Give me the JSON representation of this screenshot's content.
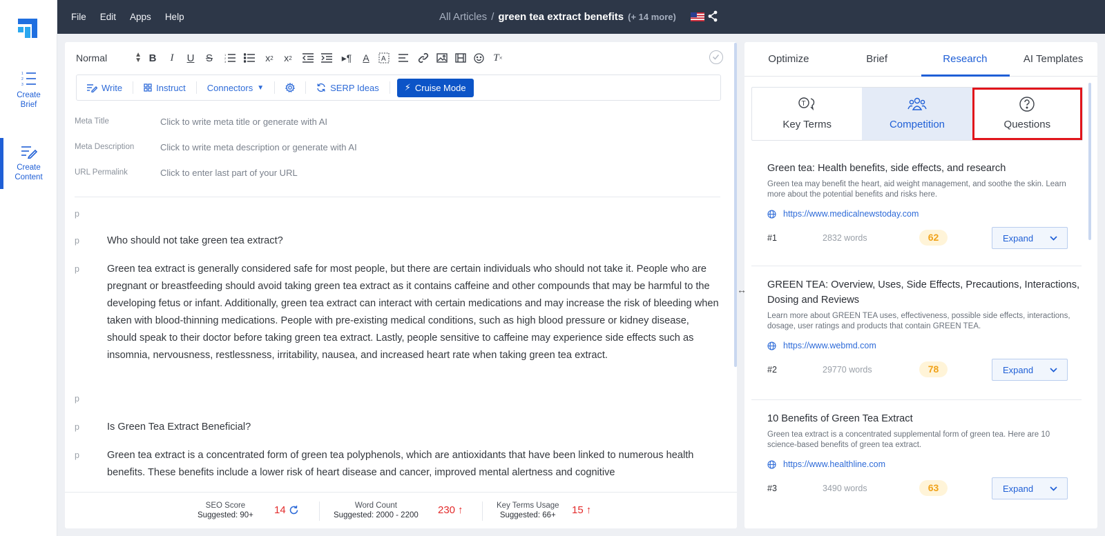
{
  "rail": {
    "create_brief": "Create\nBrief",
    "create_content": "Create\nContent"
  },
  "topbar": {
    "menu": [
      "File",
      "Edit",
      "Apps",
      "Help"
    ],
    "crumb_all": "All Articles",
    "crumb_sep": "/",
    "crumb_current": "green tea extract benefits",
    "crumb_more": "(+ 14 more)"
  },
  "editor": {
    "style_select": "Normal",
    "actions": {
      "write": "Write",
      "instruct": "Instruct",
      "connectors": "Connectors",
      "serp": "SERP Ideas",
      "cruise": "Cruise Mode"
    },
    "meta": [
      {
        "label": "Meta Title",
        "placeholder": "Click to write meta title or generate with AI"
      },
      {
        "label": "Meta Description",
        "placeholder": "Click to write meta description or generate with AI"
      },
      {
        "label": "URL Permalink",
        "placeholder": "Click to enter last part of your URL"
      }
    ],
    "paragraphs": [
      {
        "tag": "p",
        "text": ""
      },
      {
        "tag": "p",
        "text": "Who should not take green tea extract?"
      },
      {
        "tag": "p",
        "text": "Green tea extract is generally considered safe for most people, but there are certain individuals who should not take it. People who are pregnant or breastfeeding should avoid taking green tea extract as it contains caffeine and other compounds that may be harmful to the developing fetus or infant. Additionally, green tea extract can interact with certain medications and may increase the risk of bleeding when taken with blood-thinning medications. People with pre-existing medical conditions, such as high blood pressure or kidney disease, should speak to their doctor before taking green tea extract. Lastly, people sensitive to caffeine may experience side effects such as insomnia, nervousness, restlessness, irritability, nausea, and increased heart rate when taking green tea extract."
      },
      {
        "tag": "p",
        "text": ""
      },
      {
        "tag": "p",
        "text": "Is Green Tea Extract Beneficial?"
      },
      {
        "tag": "p",
        "text": "Green tea extract is a concentrated form of green tea polyphenols, which are antioxidants that have been linked to numerous health benefits. These benefits include a lower risk of heart disease and cancer, improved mental alertness and cognitive"
      }
    ],
    "stats": {
      "seo_label": "SEO Score",
      "seo_sugg": "Suggested: 90+",
      "seo_val": "14",
      "wc_label": "Word Count",
      "wc_sugg": "Suggested: 2000 - 2200",
      "wc_val": "230",
      "kt_label": "Key Terms Usage",
      "kt_sugg": "Suggested: 66+",
      "kt_val": "15"
    }
  },
  "right": {
    "tabs": [
      "Optimize",
      "Brief",
      "Research",
      "AI Templates"
    ],
    "subtabs": [
      "Key Terms",
      "Competition",
      "Questions"
    ],
    "results": [
      {
        "title": "Green tea: Health benefits, side effects, and research",
        "desc": "Green tea may benefit the heart, aid weight management, and soothe the skin. Learn more about the potential benefits and risks here.",
        "url": "https://www.medicalnewstoday.com",
        "rank": "#1",
        "words": "2832 words",
        "score": "62",
        "expand": "Expand"
      },
      {
        "title": "GREEN TEA: Overview, Uses, Side Effects, Precautions, Interactions, Dosing and Reviews",
        "desc": "Learn more about GREEN TEA uses, effectiveness, possible side effects, interactions, dosage, user ratings and products that contain GREEN TEA.",
        "url": "https://www.webmd.com",
        "rank": "#2",
        "words": "29770 words",
        "score": "78",
        "expand": "Expand"
      },
      {
        "title": "10 Benefits of Green Tea Extract",
        "desc": "Green tea extract is a concentrated supplemental form of green tea. Here are 10 science-based benefits of green tea extract.",
        "url": "https://www.healthline.com",
        "rank": "#3",
        "words": "3490 words",
        "score": "63",
        "expand": "Expand"
      }
    ]
  }
}
